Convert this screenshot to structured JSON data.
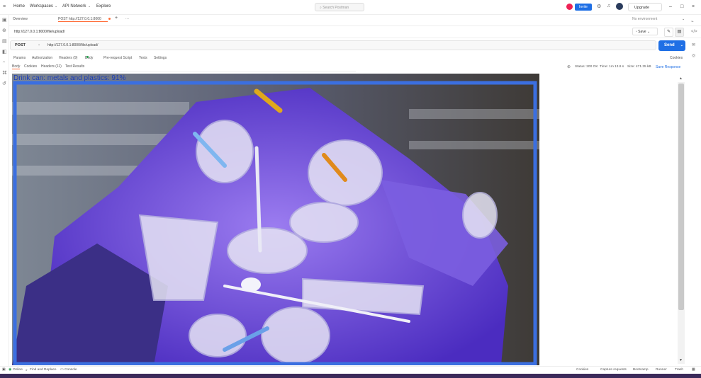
{
  "menu": {
    "home": "Home",
    "workspaces": "Workspaces",
    "api_network": "API Network",
    "explore": "Explore"
  },
  "search": {
    "placeholder": "Search Postman"
  },
  "topright": {
    "invite": "Invite",
    "upgrade": "Upgrade"
  },
  "tabs": {
    "overview": "Overview",
    "request_tab": "POST http://127.0.0.1:8000",
    "environment": "No environment"
  },
  "url_title": "http://127.0.0.1:8000/file/upload/",
  "save": "Save",
  "request": {
    "method": "POST",
    "url": "http://127.0.0.1:8000/file/upload/",
    "send": "Send"
  },
  "subtabs": [
    "Params",
    "Authorization",
    "Headers (9)",
    "Body",
    "Pre-request Script",
    "Tests",
    "Settings"
  ],
  "cookies_link": "Cookies",
  "resptabs": [
    "Body",
    "Cookies",
    "Headers (11)",
    "Test Results"
  ],
  "response_meta": {
    "status": "Status: 200 OK",
    "time": "Time: 1m 13.9 s",
    "size": "Size: 471.35 kB",
    "save_response": "Save Response"
  },
  "detection": {
    "label": "Drink can: metals and plastics: 91%",
    "box_color": "#3b6fe0"
  },
  "footer": {
    "online": "Online",
    "find_replace": "Find and Replace",
    "console": "Console",
    "cookies": "Cookies",
    "capture": "Capture requests",
    "bootcamp": "Bootcamp",
    "runner": "Runner",
    "trash": "Trash"
  }
}
